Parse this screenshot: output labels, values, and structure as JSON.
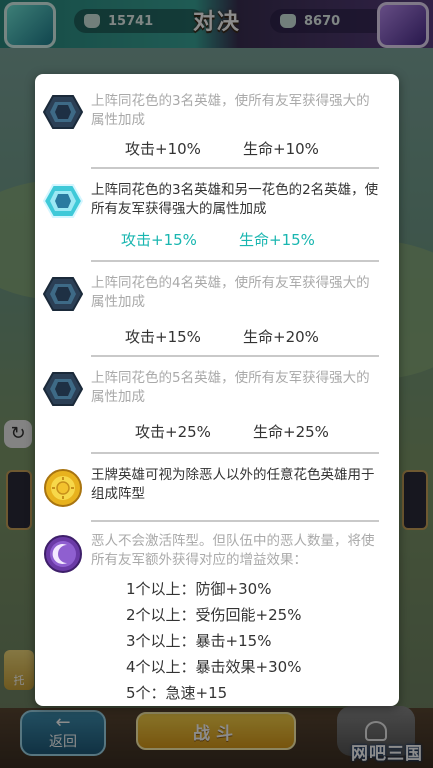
{
  "header": {
    "title": "对决",
    "left_score": "15741",
    "right_score": "8670"
  },
  "synergies": [
    {
      "icon": "hexagon-emblem-icon",
      "active": false,
      "desc": "上阵同花色的3名英雄，使所有友军获得强大的属性加成",
      "attack": "攻击+10%",
      "life": "生命+10%"
    },
    {
      "icon": "hexagon-emblem-glowing-icon",
      "active": true,
      "desc": "上阵同花色的3名英雄和另一花色的2名英雄，使所有友军获得强大的属性加成",
      "attack": "攻击+15%",
      "life": "生命+15%"
    },
    {
      "icon": "hexagon-emblem-icon",
      "active": false,
      "desc": "上阵同花色的4名英雄，使所有友军获得强大的属性加成",
      "attack": "攻击+15%",
      "life": "生命+20%"
    },
    {
      "icon": "hexagon-emblem-icon",
      "active": false,
      "desc": "上阵同花色的5名英雄，使所有友军获得强大的属性加成",
      "attack": "攻击+25%",
      "life": "生命+25%"
    }
  ],
  "ace": {
    "icon": "sun-emblem-icon",
    "desc": "王牌英雄可视为除恶人以外的任意花色英雄用于组成阵型"
  },
  "villain": {
    "icon": "moon-emblem-icon",
    "desc": "恶人不会激活阵型。但队伍中的恶人数量，将使所有友军额外获得对应的增益效果：",
    "bonuses": [
      "1个以上：防御+30%",
      "2个以上：受伤回能+25%",
      "3个以上：暴击+15%",
      "4个以上：暴击效果+30%",
      "5个：急速+15"
    ]
  },
  "footer": {
    "back_label": "返回",
    "fight_label": "战斗",
    "auto_label": "托"
  },
  "watermark": "网吧三国",
  "colors": {
    "active_stat": "#19b6b0",
    "dim_text": "#a9a9a9",
    "panel_bg": "#ffffff"
  }
}
